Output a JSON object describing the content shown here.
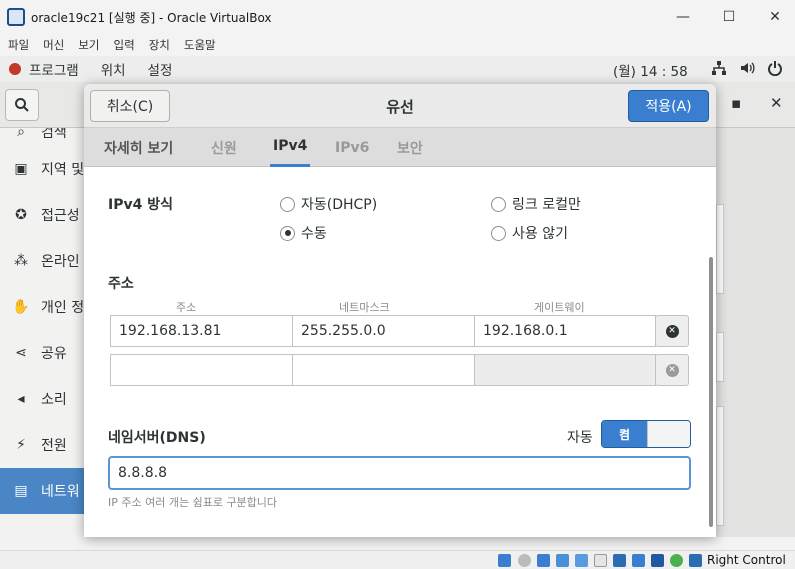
{
  "window": {
    "title": "oracle19c21 [실행 중] - Oracle VirtualBox",
    "minimize": "—",
    "maximize": "☐",
    "close": "✕"
  },
  "menubar": [
    "파일",
    "머신",
    "보기",
    "입력",
    "장치",
    "도움말"
  ],
  "guestbar": {
    "apps": "프로그램",
    "places": "위치",
    "settings": "설정",
    "clock": "(월) 14 : 58"
  },
  "settings_sidebar": [
    {
      "label": "검색"
    },
    {
      "label": "지역 및"
    },
    {
      "label": "접근성"
    },
    {
      "label": "온라인"
    },
    {
      "label": "개인 정"
    },
    {
      "label": "공유"
    },
    {
      "label": "소리"
    },
    {
      "label": "전원"
    },
    {
      "label": "네트워"
    }
  ],
  "dialog": {
    "title": "유선",
    "cancel": "취소(C)",
    "apply": "적용(A)",
    "tabs": [
      "자세히 보기",
      "신원",
      "IPv4",
      "IPv6",
      "보안"
    ],
    "selected_tab": "IPv4",
    "method_label": "IPv4 방식",
    "methods": {
      "dhcp": "자동(DHCP)",
      "link_local": "링크 로컬만",
      "manual": "수동",
      "disabled": "사용 않기"
    },
    "selected_method": "수동",
    "address_label": "주소",
    "columns": [
      "주소",
      "네트마스크",
      "게이트웨이"
    ],
    "rows": [
      {
        "address": "192.168.13.81",
        "netmask": "255.255.0.0",
        "gateway": "192.168.0.1"
      },
      {
        "address": "",
        "netmask": "",
        "gateway": ""
      }
    ],
    "dns_label": "네임서버(DNS)",
    "dns_auto_label": "자동",
    "dns_auto_toggle": "켬",
    "dns_value": "8.8.8.8",
    "dns_hint": "IP 주소 여러 개는 쉼표로 구분합니다"
  },
  "statusbar": {
    "host_key": "Right Control"
  }
}
